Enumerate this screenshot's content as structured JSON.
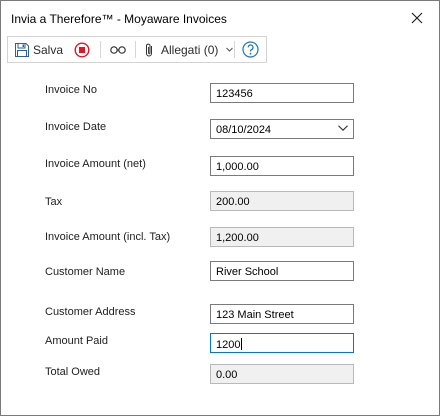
{
  "window": {
    "title": "Invia a Therefore™ - Moyaware Invoices"
  },
  "toolbar": {
    "save_label": "Salva",
    "attachments_label": "Allegati (0)"
  },
  "icons": {
    "save": "floppy-disk-icon",
    "stop": "stop-record-icon",
    "link": "chain-link-icon",
    "attach": "paperclip-icon",
    "dropdown": "chevron-down-icon",
    "help": "question-mark-icon",
    "close": "close-icon"
  },
  "colors": {
    "stop_red": "#e81123",
    "help_blue": "#1a73c8",
    "focus_border": "#0078d7"
  },
  "form": {
    "invoice_no": {
      "label": "Invoice No",
      "value": "123456"
    },
    "invoice_date": {
      "label": "Invoice Date",
      "value": "08/10/2024"
    },
    "invoice_amount_net": {
      "label": "Invoice Amount (net)",
      "value": "1,000.00"
    },
    "tax": {
      "label": "Tax",
      "value": "200.00"
    },
    "invoice_amount_incl": {
      "label": "Invoice Amount (incl. Tax)",
      "value": "1,200.00"
    },
    "customer_name": {
      "label": "Customer Name",
      "value": "River School"
    },
    "customer_address": {
      "label": "Customer Address",
      "value": "123 Main Street"
    },
    "amount_paid": {
      "label": "Amount Paid",
      "value": "1200"
    },
    "total_owed": {
      "label": "Total Owed",
      "value": "0.00"
    }
  }
}
